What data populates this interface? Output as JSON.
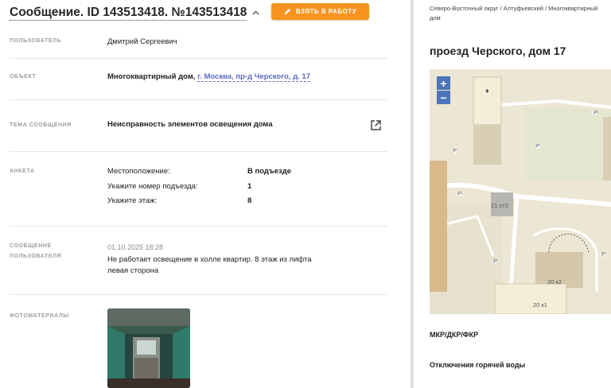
{
  "header": {
    "title": "Сообщение. ID 143513418. №143513418",
    "take_button": "ВЗЯТЬ В РАБОТУ"
  },
  "fields": {
    "user": {
      "label": "ПОЛЬЗОВАТЕЛЬ",
      "value": "Дмитрий Сергеевич"
    },
    "object": {
      "label": "ОБЪЕКТ",
      "value_prefix": "Многоквартирный дом, ",
      "value_link": "г. Москва, пр-д Черского, д. 17"
    },
    "subject": {
      "label": "ТЕМА СООБЩЕНИЯ",
      "value": "Неисправность элементов освещения дома"
    },
    "survey": {
      "label": "АНКЕТА",
      "rows": [
        {
          "q": "Местоположение:",
          "a": "В подъезде"
        },
        {
          "q": "Укажите номер подъезда:",
          "a": "1"
        },
        {
          "q": "Укажите этаж:",
          "a": "8"
        }
      ]
    },
    "message": {
      "label_line1": "СООБЩЕНИЕ",
      "label_line2": "ПОЛЬЗОВАТЕЛЯ",
      "date": "01.10.2025 18:28",
      "text": "Не работает освещение в холле квартир. 8 этаж из лифта левая сторона"
    },
    "photos": {
      "label": "ФОТОМАТЕРИАЛЫ"
    }
  },
  "right": {
    "breadcrumb": "Северо-Восточный округ / Алтуфьевский / Многоквартирный дом",
    "address": "проезд Черского, дом 17",
    "map": {
      "zoom_in": "+",
      "zoom_out": "−",
      "labels": {
        "b1": "21 ст2",
        "b2": "20 к2",
        "b3": "20 к1",
        "p": "P"
      }
    },
    "items": [
      "МКР/ДКР/ФКР",
      "Отключения горячей воды"
    ]
  },
  "colors": {
    "accent": "#f7931e",
    "link": "#5c6bc0",
    "zoom": "#4d74b8"
  }
}
